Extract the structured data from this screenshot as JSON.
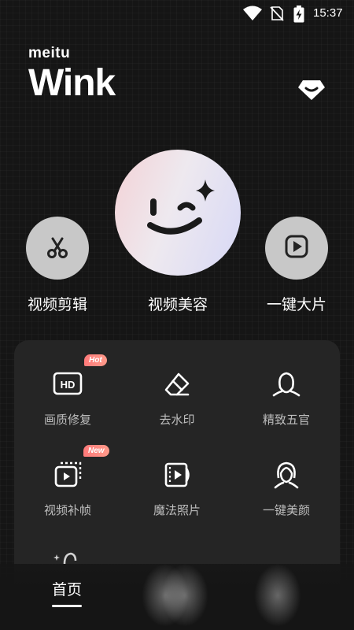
{
  "status_bar": {
    "time": "15:37",
    "icons": [
      "wifi-icon",
      "no-sim-icon",
      "battery-charging-icon"
    ]
  },
  "brand": {
    "sub": "meitu",
    "title": "Wink"
  },
  "header": {
    "vip_icon": "diamond-icon"
  },
  "hero": {
    "items": [
      {
        "label": "视频剪辑",
        "icon": "scissors-icon"
      },
      {
        "label": "视频美容",
        "icon": "wink-face-icon"
      },
      {
        "label": "一键大片",
        "icon": "play-square-icon"
      }
    ]
  },
  "tools": {
    "items": [
      {
        "label": "画质修复",
        "icon": "hd-icon",
        "badge": "Hot"
      },
      {
        "label": "去水印",
        "icon": "eraser-icon"
      },
      {
        "label": "精致五官",
        "icon": "face-outline-icon"
      },
      {
        "label": "视频补帧",
        "icon": "video-frames-icon",
        "badge": "New"
      },
      {
        "label": "魔法照片",
        "icon": "film-icon"
      },
      {
        "label": "一键美颜",
        "icon": "woman-face-icon"
      }
    ]
  },
  "bottom_nav": {
    "home": "首页"
  }
}
